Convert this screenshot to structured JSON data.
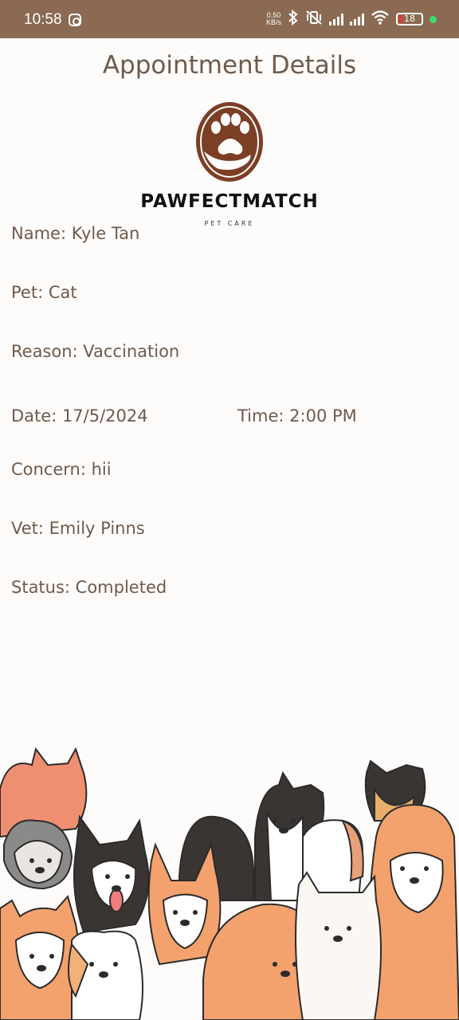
{
  "status_bar": {
    "time": "10:58",
    "net_speed_value": "0.50",
    "net_speed_unit": "KB/s",
    "battery": "18"
  },
  "header": {
    "title": "Appointment Details"
  },
  "logo": {
    "brand": "PAWFECTMATCH",
    "tagline": "PET CARE",
    "icon": "paw-in-hand"
  },
  "appointment": {
    "name": "Name: Kyle Tan",
    "pet": "Pet: Cat",
    "reason": "Reason: Vaccination",
    "date": "Date: 17/5/2024",
    "time": "Time: 2:00 PM",
    "concern": "Concern: hii",
    "vet": "Vet: Emily Pinns",
    "status": "Status: Completed"
  },
  "theme": {
    "status_bar_color": "#8a6a52",
    "text_color": "#6e5a4c",
    "logo_color": "#7b3f26",
    "background": "#fdfcfa"
  }
}
